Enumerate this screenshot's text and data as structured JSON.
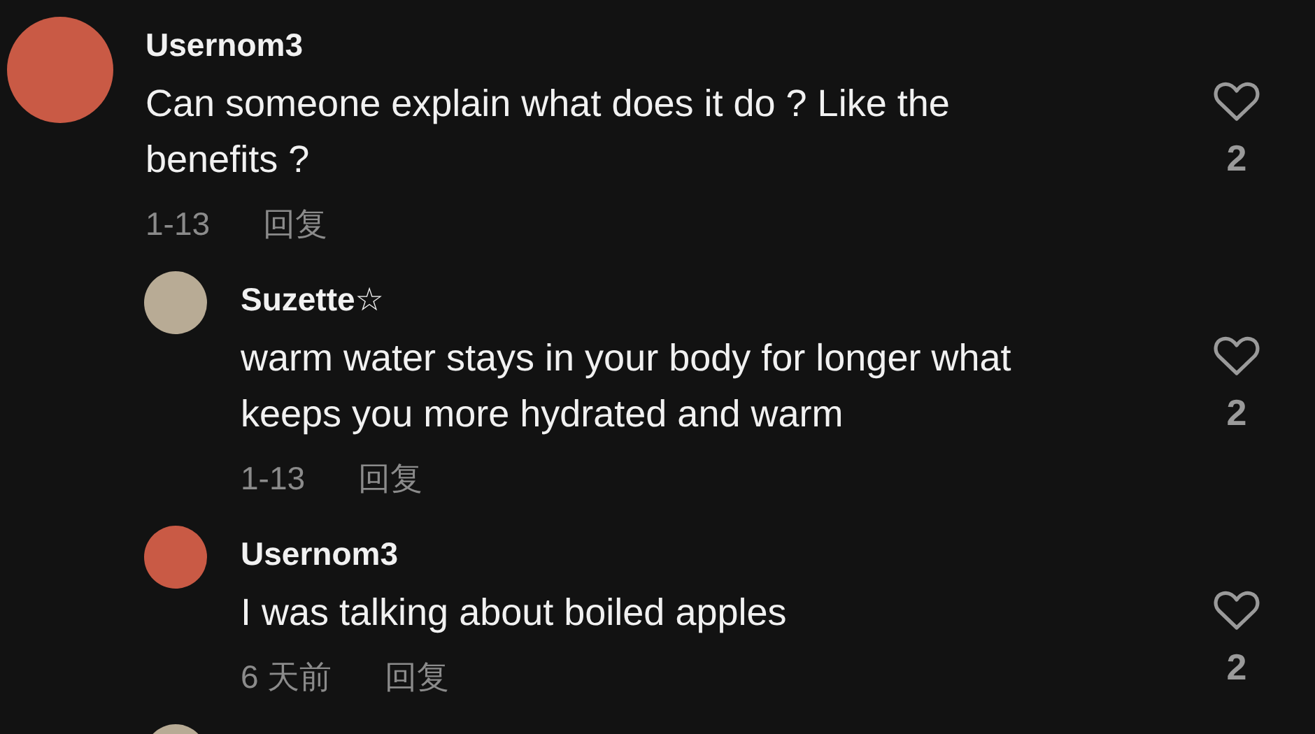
{
  "comments": [
    {
      "kind": "full",
      "author": "Usernom3",
      "color": "#c95a45",
      "text": "Can someone explain what does it do ? Like the benefits ?",
      "date": "1-13",
      "reply_label": "回复",
      "likes": "2",
      "replies": [
        {
          "kind": "full",
          "author": "Suzette☆",
          "color": "#b8ab95",
          "text": "warm water stays in your body for longer what keeps you more hydrated and warm",
          "date": "1-13",
          "reply_label": "回复",
          "likes": "2"
        },
        {
          "kind": "full",
          "author": "Usernom3",
          "color": "#c95a45",
          "text": "I was talking about boiled apples",
          "date": "6 天前",
          "reply_label": "回复",
          "likes": "2"
        },
        {
          "kind": "cut",
          "color": "#b8ab95"
        }
      ]
    }
  ]
}
